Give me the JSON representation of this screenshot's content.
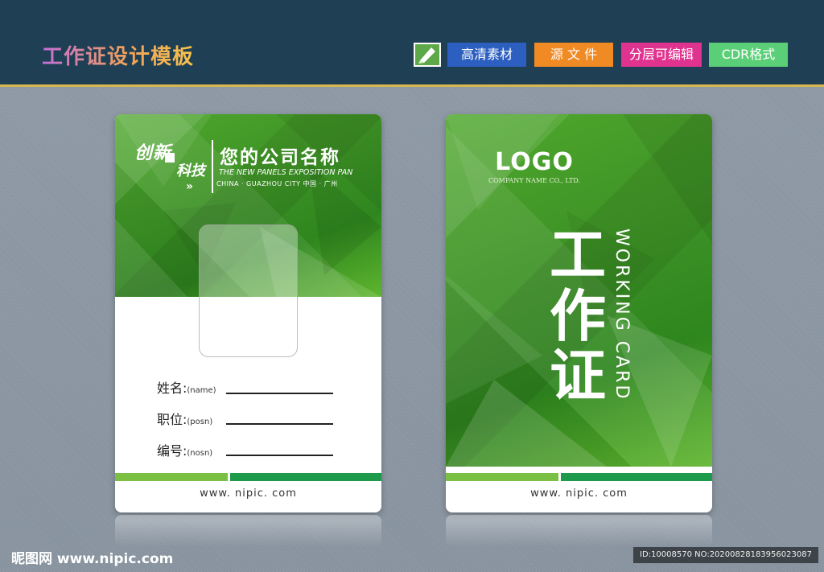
{
  "header": {
    "title": "工作证设计模板",
    "tags": [
      "高清素材",
      "源 文 件",
      "分层可编辑",
      "CDR格式"
    ],
    "tag_colors": [
      "#2c5fc0",
      "#f08a24",
      "#e0338f",
      "#5bcf77"
    ],
    "icon": "pen-tool-icon"
  },
  "front": {
    "brand_line1": "创新",
    "brand_line2": "科技",
    "brand_arrows": "»",
    "company_name": "您的公司名称",
    "company_en": "THE NEW PANELS EXPOSITION PAN",
    "company_city": "CHINA · GUAZHOU CITY  中国 · 广州",
    "fields": [
      {
        "label": "姓名:",
        "hint": "(name)"
      },
      {
        "label": "职位:",
        "hint": "(posn)"
      },
      {
        "label": "编号:",
        "hint": "(nosn)"
      }
    ],
    "website": "www. nipic. com"
  },
  "back": {
    "logo": "LOGO",
    "logo_sub": "COMPANY NAME CO., LTD.",
    "big_chars": [
      "工",
      "作",
      "证"
    ],
    "vertical_text": "WORKING CARD",
    "website": "www. nipic. com"
  },
  "footer": {
    "watermark": "昵图网 www.nipic.com",
    "id_text": "ID:10008570 NO:20200828183956023087"
  },
  "colors": {
    "header_bg": "#1f3f55",
    "green": "#3e9326",
    "light_green_bar": "#7ac043",
    "dark_green_bar": "#1d9a4a"
  }
}
